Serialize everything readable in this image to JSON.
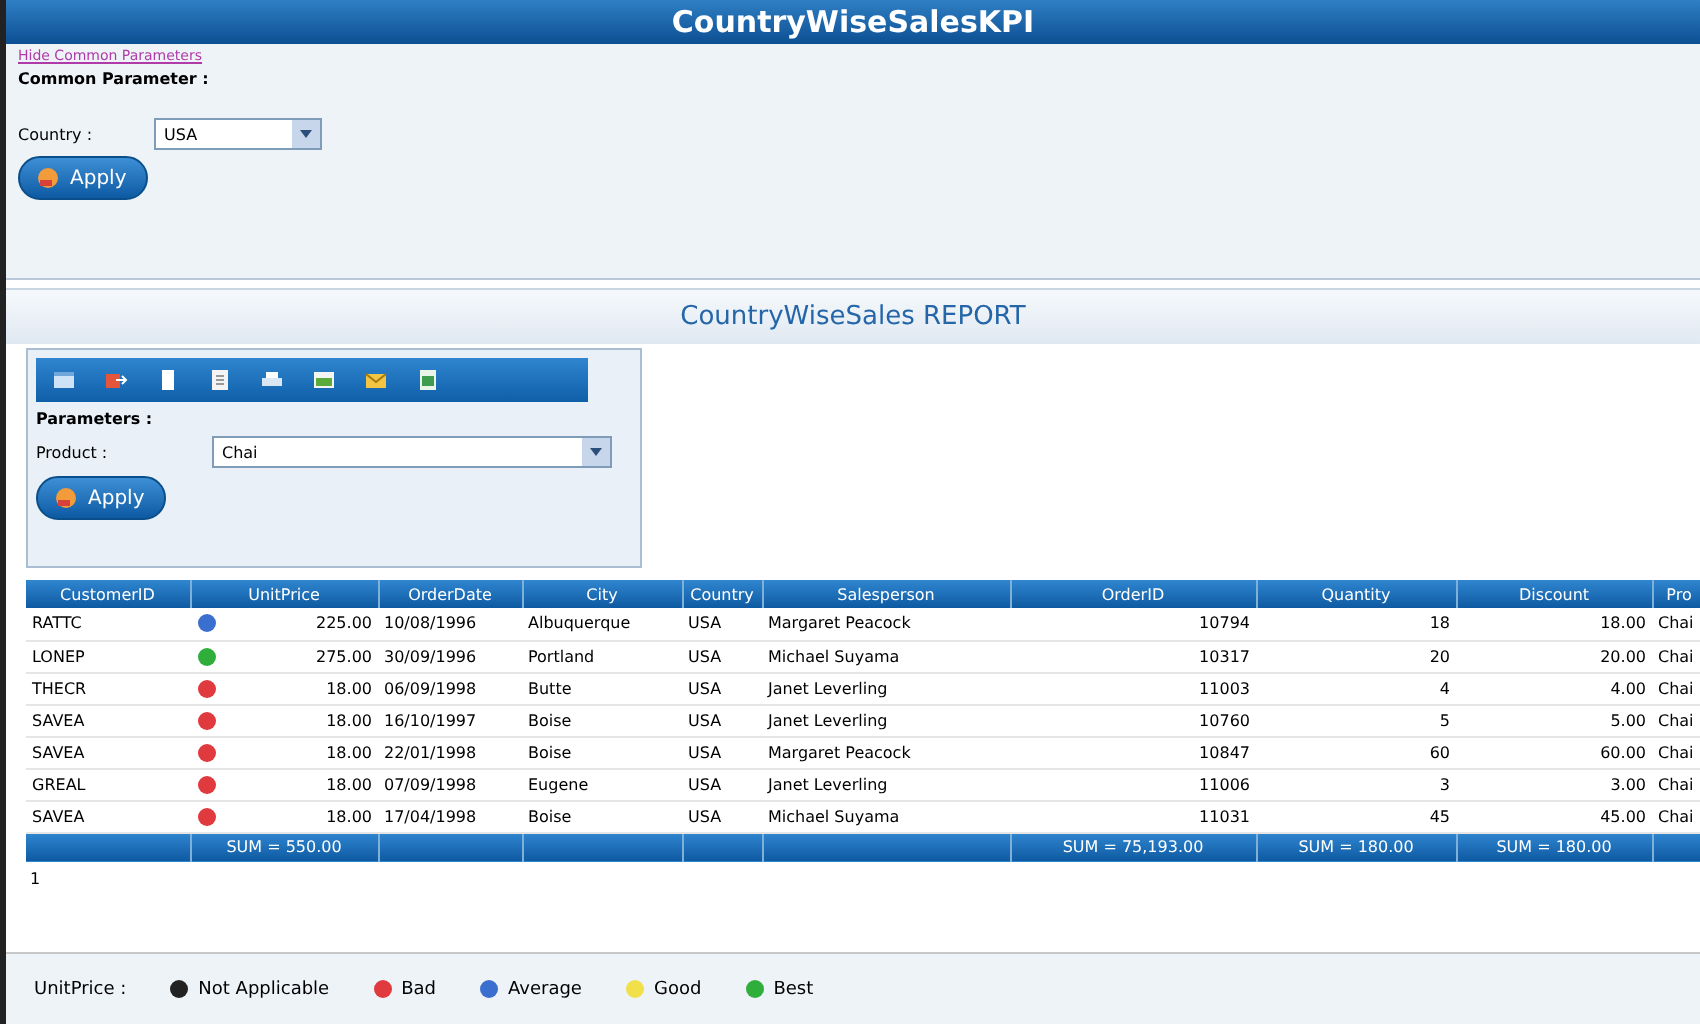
{
  "window": {
    "title": "CountryWiseSalesKPI"
  },
  "common": {
    "link": "Hide Common Parameters",
    "heading": "Common Parameter :",
    "country_label": "Country :",
    "country_value": "USA",
    "apply": "Apply"
  },
  "report": {
    "title": "CountryWiseSales REPORT",
    "toolbar_icons": [
      {
        "kind": "window"
      },
      {
        "kind": "export"
      },
      {
        "kind": "document"
      },
      {
        "kind": "page"
      },
      {
        "kind": "print"
      },
      {
        "kind": "image"
      },
      {
        "kind": "mail"
      },
      {
        "kind": "spreadsheet"
      }
    ],
    "parameters_heading": "Parameters :",
    "product_label": "Product :",
    "product_value": "Chai",
    "apply": "Apply"
  },
  "table": {
    "columns": [
      "CustomerID",
      "UnitPrice",
      "OrderDate",
      "City",
      "Country",
      "Salesperson",
      "OrderID",
      "Quantity",
      "Discount",
      "Pro"
    ],
    "rows": [
      {
        "customer": "RATTC",
        "color": "#3a6fd0",
        "price": "225.00",
        "date": "10/08/1996",
        "city": "Albuquerque",
        "country": "USA",
        "salesperson": "Margaret Peacock",
        "order": "10794",
        "quantity": "18",
        "discount": "18.00",
        "product": "Chai"
      },
      {
        "customer": "LONEP",
        "color": "#2fae3c",
        "price": "275.00",
        "date": "30/09/1996",
        "city": "Portland",
        "country": "USA",
        "salesperson": "Michael Suyama",
        "order": "10317",
        "quantity": "20",
        "discount": "20.00",
        "product": "Chai"
      },
      {
        "customer": "THECR",
        "color": "#e0393e",
        "price": "18.00",
        "date": "06/09/1998",
        "city": "Butte",
        "country": "USA",
        "salesperson": "Janet Leverling",
        "order": "11003",
        "quantity": "4",
        "discount": "4.00",
        "product": "Chai"
      },
      {
        "customer": "SAVEA",
        "color": "#e0393e",
        "price": "18.00",
        "date": "16/10/1997",
        "city": "Boise",
        "country": "USA",
        "salesperson": "Janet Leverling",
        "order": "10760",
        "quantity": "5",
        "discount": "5.00",
        "product": "Chai"
      },
      {
        "customer": "SAVEA",
        "color": "#e0393e",
        "price": "18.00",
        "date": "22/01/1998",
        "city": "Boise",
        "country": "USA",
        "salesperson": "Margaret Peacock",
        "order": "10847",
        "quantity": "60",
        "discount": "60.00",
        "product": "Chai"
      },
      {
        "customer": "GREAL",
        "color": "#e0393e",
        "price": "18.00",
        "date": "07/09/1998",
        "city": "Eugene",
        "country": "USA",
        "salesperson": "Janet Leverling",
        "order": "11006",
        "quantity": "3",
        "discount": "3.00",
        "product": "Chai"
      },
      {
        "customer": "SAVEA",
        "color": "#e0393e",
        "price": "18.00",
        "date": "17/04/1998",
        "city": "Boise",
        "country": "USA",
        "salesperson": "Michael Suyama",
        "order": "11031",
        "quantity": "45",
        "discount": "45.00",
        "product": "Chai"
      }
    ],
    "footer": {
      "price": "SUM = 550.00",
      "order": "SUM = 75,193.00",
      "quantity": "SUM = 180.00",
      "discount": "SUM = 180.00"
    }
  },
  "pager": "1",
  "legend": {
    "label": "UnitPrice :",
    "items": [
      {
        "label": "Not Applicable",
        "color": "#222222"
      },
      {
        "label": "Bad",
        "color": "#e0393e"
      },
      {
        "label": "Average",
        "color": "#3a6fd0"
      },
      {
        "label": "Good",
        "color": "#f2e04a"
      },
      {
        "label": "Best",
        "color": "#2fae3c"
      }
    ]
  }
}
